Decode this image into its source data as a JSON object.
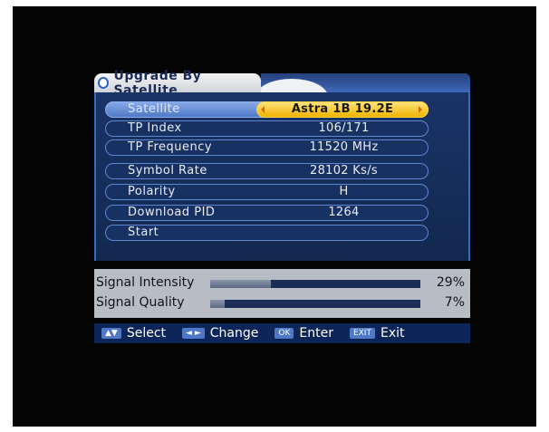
{
  "menu": {
    "title": "Upgrade By Satellite"
  },
  "rows": [
    {
      "label": "Satellite",
      "value": "Astra 1B 19.2E",
      "selected": true
    },
    {
      "label": "TP Index",
      "value": "106/171"
    },
    {
      "label": "TP Frequency",
      "value": "11520 MHz"
    },
    {
      "label": "Symbol Rate",
      "value": "28102 Ks/s"
    },
    {
      "label": "Polarity",
      "value": "H"
    },
    {
      "label": "Download PID",
      "value": "1264"
    },
    {
      "label": "Start",
      "value": ""
    }
  ],
  "signal": {
    "intensity": {
      "label": "Signal Intensity",
      "value_text": "29%",
      "level": 0.29
    },
    "quality": {
      "label": "Signal Quality",
      "value_text": "7%",
      "level": 0.07
    }
  },
  "help": [
    {
      "key": "▲▼",
      "label": "Select"
    },
    {
      "key": "◄ ►",
      "label": "Change"
    },
    {
      "key": "OK",
      "label": "Enter"
    },
    {
      "key": "EXIT",
      "label": "Exit"
    }
  ],
  "colors": {
    "panel": "#173262",
    "selected": "#f0b400",
    "help_bar": "#0d2558"
  }
}
